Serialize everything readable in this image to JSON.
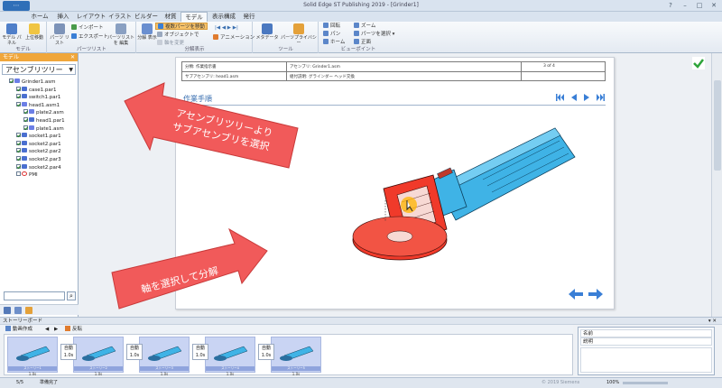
{
  "app": {
    "title": "Solid Edge ST Publishing 2019 - [Grinder1]",
    "menu_button": "",
    "window_buttons": [
      "?",
      "–",
      "□",
      "✕"
    ]
  },
  "ribbon_tabs": [
    "ホーム",
    "挿入",
    "レイアウト",
    "イラスト",
    "ビルダー",
    "材質",
    "モデル",
    "表示構成",
    "発行"
  ],
  "active_tab": "モデル",
  "ribbon": {
    "model_group": {
      "model_panel": "モデル パネル",
      "top_bottom": "上位移動",
      "label": "モデル"
    },
    "parts_list_group": {
      "parts_list": "パーツ リスト",
      "import": "インポート",
      "export": "エクスポート",
      "edit_parts_list": "パーツリストを 編集",
      "label": "パーツリスト"
    },
    "explode_group": {
      "explode_display": "分解 表示",
      "move_parts_highlight": "複数パーツを移動",
      "object_unset": "オブジェクトで",
      "axis_change": "軸を変更",
      "animation": "アニメーション",
      "label": "分解表示"
    },
    "tools_group": {
      "metadata": "メタデータ",
      "parts_privacy": "パーツプライバシー",
      "label": "ツール"
    },
    "viewpoint_group": {
      "rotate": "回転",
      "pan": "パン",
      "home": "ホーム",
      "zoom": "ズーム",
      "select_parts": "パーツを選択 ▾",
      "front": "正面",
      "label": "ビューポイント"
    }
  },
  "left_panel": {
    "header": "モデル",
    "dropdown_value": "アセンブリツリー",
    "tree": [
      {
        "label": "Grinder1.asm",
        "kind": "asm",
        "checked": true,
        "indent": 0
      },
      {
        "label": "case1.par1",
        "kind": "par",
        "checked": true,
        "indent": 1
      },
      {
        "label": "switch1.par1",
        "kind": "par",
        "checked": true,
        "indent": 1
      },
      {
        "label": "head1.asm1",
        "kind": "asm",
        "checked": true,
        "indent": 1
      },
      {
        "label": "plate2.asm",
        "kind": "asm",
        "checked": true,
        "indent": 2
      },
      {
        "label": "head1.par1",
        "kind": "par",
        "checked": true,
        "indent": 2
      },
      {
        "label": "plate1.asm",
        "kind": "asm",
        "checked": true,
        "indent": 2
      },
      {
        "label": "socket1.par1",
        "kind": "par",
        "checked": true,
        "indent": 1
      },
      {
        "label": "socket2.par1",
        "kind": "par",
        "checked": true,
        "indent": 1
      },
      {
        "label": "socket2.par2",
        "kind": "par",
        "checked": true,
        "indent": 1
      },
      {
        "label": "socket2.par3",
        "kind": "par",
        "checked": true,
        "indent": 1
      },
      {
        "label": "socket2.par4",
        "kind": "par",
        "checked": true,
        "indent": 1
      },
      {
        "label": "PMI",
        "kind": "pmi",
        "checked": false,
        "indent": 1
      }
    ]
  },
  "document": {
    "header_table": {
      "r1c1": "分類: 作業指示書",
      "r1c2": "アセンブリ: Grinder1.asm",
      "r1c3": "3 of 4",
      "r2c1": "サブアセンブリ: head1.asm",
      "r2c2": "組付説明: グラインダー ヘッド交換"
    },
    "section_title": "作業手順",
    "callout_top": "アセンブリツリーより サブアセンブリを選択",
    "callout_top_line1": "アセンブリツリーより",
    "callout_top_line2": "サブアセンブリを選択",
    "callout_bottom": "軸を選択して分解"
  },
  "storyboard": {
    "header": "ストーリーボード",
    "toolbar": {
      "create_anim": "動画作成",
      "reverse": "反転"
    },
    "frames": [
      {
        "caption": "ストーリー1",
        "time": "1.0s"
      },
      {
        "caption": "ストーリー2",
        "time": "1.0s"
      },
      {
        "caption": "ストーリー3",
        "time": "1.0s"
      },
      {
        "caption": "ストーリー4",
        "time": "1.0s"
      },
      {
        "caption": "ストーリー5",
        "time": "1.0s"
      }
    ],
    "anim_steps": [
      {
        "label": "自動",
        "time": "1.0s"
      },
      {
        "label": "自動",
        "time": "1.0s"
      },
      {
        "label": "自動",
        "time": "1.0s"
      },
      {
        "label": "自動",
        "time": "1.0s"
      }
    ]
  },
  "properties": {
    "name_label": "名前",
    "desc_label": "説明"
  },
  "status": {
    "page": "5/5",
    "state": "準備完了",
    "zoom": "100%",
    "copyright": "© 2019 Siemens"
  },
  "colors": {
    "accent_orange": "#f0a63a",
    "callout_red": "#f15a5a",
    "model_cyan": "#3fb3e6",
    "model_red": "#f03a2a",
    "nav_blue": "#3a7fd6"
  }
}
